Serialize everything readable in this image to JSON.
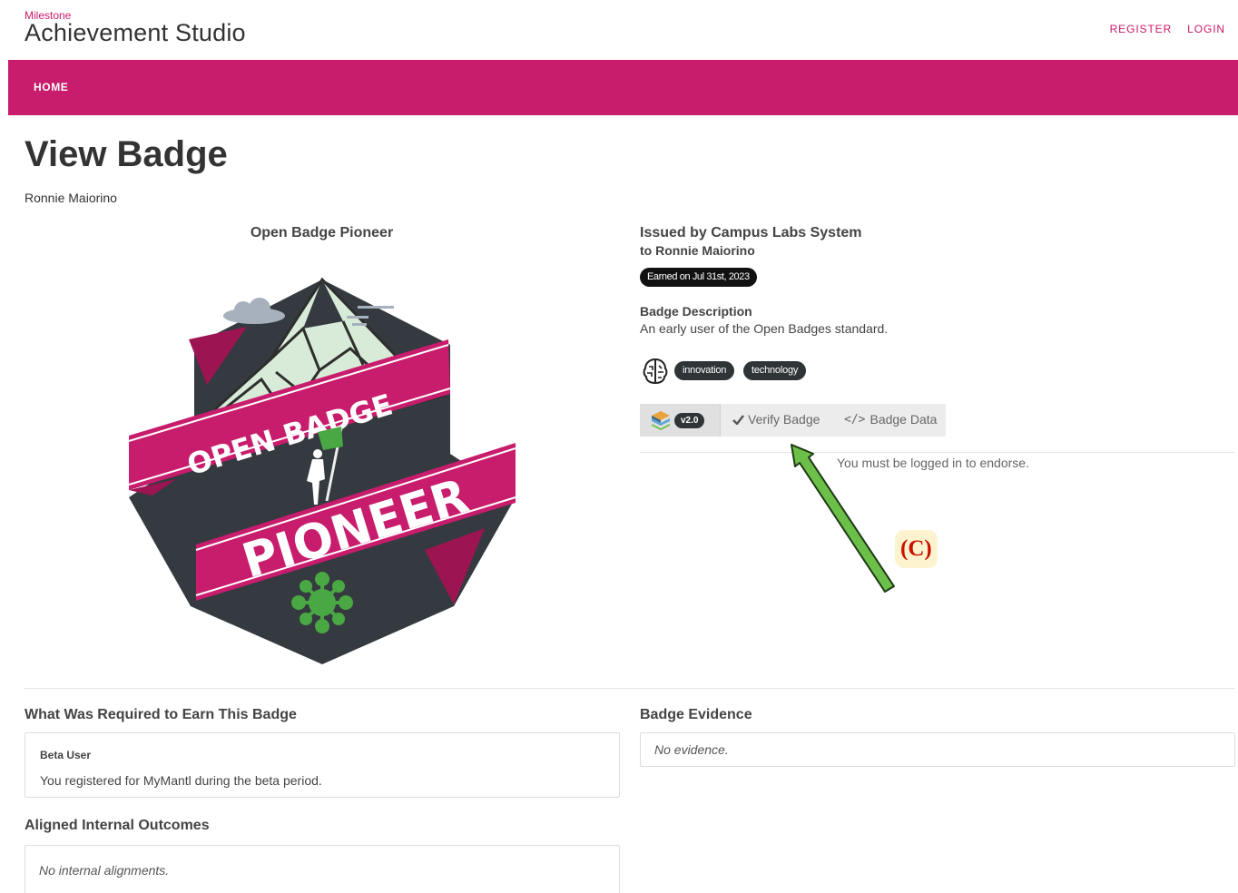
{
  "brand": {
    "small": "Milestone",
    "big": "Achievement Studio"
  },
  "auth": {
    "register": "REGISTER",
    "login": "LOGIN"
  },
  "nav": {
    "home": "HOME"
  },
  "page": {
    "title": "View Badge",
    "owner": "Ronnie Maiorino"
  },
  "badge": {
    "name": "Open Badge Pioneer",
    "art_text_top": "OPEN BADGE",
    "art_text_bottom": "PIONEER",
    "issuer": "Issued by Campus Labs System",
    "recipient": "to Ronnie Maiorino",
    "earned": "Earned on Jul 31st, 2023",
    "description_label": "Badge Description",
    "description": "An early user of the Open Badges standard.",
    "tags": [
      "innovation",
      "technology"
    ]
  },
  "toolbar": {
    "version": "v2.0",
    "verify_label": "Verify Badge",
    "data_label": "Badge Data",
    "code_glyph": "</>"
  },
  "endorse": {
    "message": "You must be logged in to endorse."
  },
  "annotation": {
    "label": "(C)"
  },
  "requirements": {
    "heading": "What Was Required to Earn This Badge",
    "title": "Beta User",
    "text": "You registered for MyMantl during the beta period."
  },
  "evidence": {
    "heading": "Badge Evidence",
    "text": "No evidence."
  },
  "alignments": {
    "heading": "Aligned Internal Outcomes",
    "text": "No internal alignments."
  },
  "colors": {
    "accent": "#c81c6c",
    "pill_dark": "#2f3437",
    "annotation_arrow": "#6cc04a",
    "annotation_text": "#cc1100"
  }
}
